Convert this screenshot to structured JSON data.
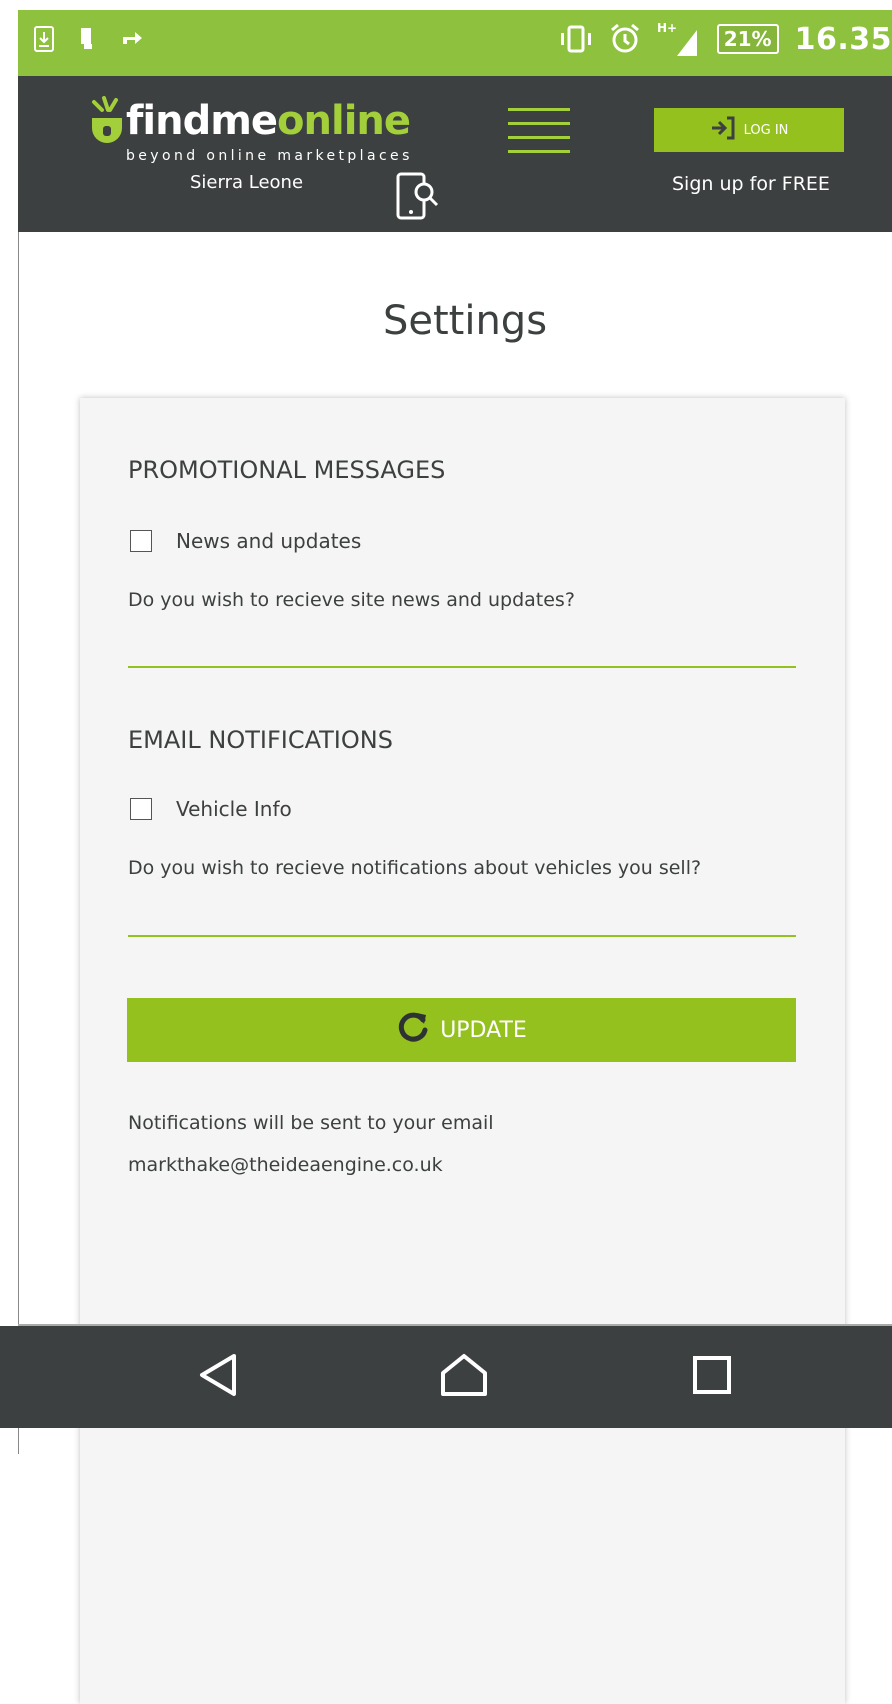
{
  "status_bar": {
    "battery": "21%",
    "time": "16.35",
    "network": "H+"
  },
  "header": {
    "logo_main": "findme",
    "logo_accent": "online",
    "logo_tagline": "beyond online marketplaces",
    "login_label": "LOG IN",
    "country": "Sierra Leone",
    "signup_label": "Sign up for FREE"
  },
  "page": {
    "title": "Settings"
  },
  "promotional": {
    "heading": "PROMOTIONAL MESSAGES",
    "checkbox_label": "News and updates",
    "description": "Do you wish to recieve site news and updates?"
  },
  "email_notifications": {
    "heading": "EMAIL NOTIFICATIONS",
    "checkbox_label": "Vehicle Info",
    "description": "Do you wish to recieve notifications about vehicles you sell?"
  },
  "update_button": {
    "label": "UPDATE"
  },
  "footer_note": {
    "line1": "Notifications will be sent to your email",
    "email": "markthake@theideaengine.co.uk"
  },
  "colors": {
    "brand_green": "#95c11f",
    "header_dark": "#3d4040",
    "status_green": "#8ec13e"
  }
}
